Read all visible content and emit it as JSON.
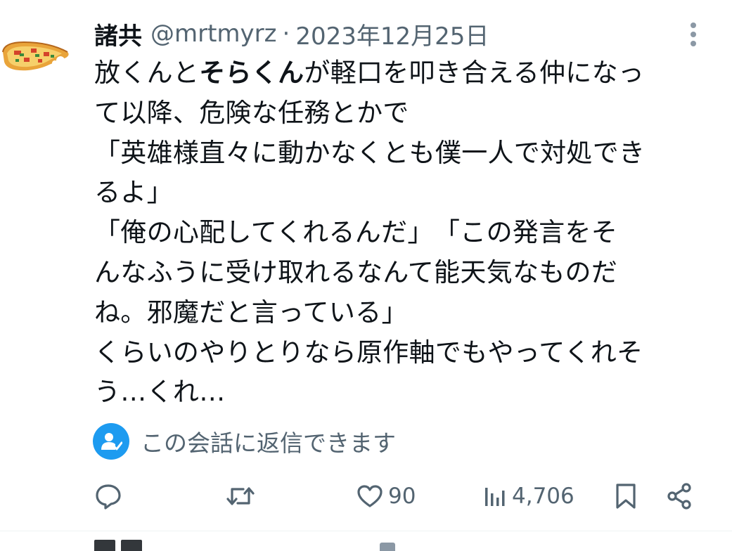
{
  "tweet": {
    "author_name": "諸共",
    "handle": "@mrtmyrz",
    "separator": "·",
    "date": "2023年12月25日",
    "body": {
      "line1_pre": "放くんと",
      "line1_bold": "そらくん",
      "line1_post": "が軽口を叩き合える仲になっ",
      "line2": "て以降、危険な任務とかで",
      "line3": "「英雄様直々に動かなくとも僕一人で対処でき",
      "line4": "るよ」",
      "line5": "「俺の心配してくれるんだ」　「この発言をそ",
      "line6": "んなふうに受け取れるなんて能天気なものだ",
      "line7": "ね。邪魔だと言っている」",
      "line8": "くらいのやりとりなら原作軸でもやってくれそ",
      "line9": "う…くれ…"
    }
  },
  "reply_notice": {
    "text": "この会話に返信できます",
    "icon": "person-check-icon",
    "icon_color": "#1d9bf0"
  },
  "actions": {
    "reply": {
      "icon": "reply-bubble-icon"
    },
    "retweet": {
      "icon": "retweet-icon"
    },
    "like": {
      "icon": "heart-icon",
      "count": "90"
    },
    "views": {
      "icon": "bar-chart-icon",
      "count": "4,706"
    },
    "bookmark": {
      "icon": "bookmark-icon"
    },
    "share": {
      "icon": "share-icon"
    }
  },
  "colors": {
    "text_primary": "#0f1419",
    "text_secondary": "#536471",
    "accent": "#1d9bf0"
  }
}
